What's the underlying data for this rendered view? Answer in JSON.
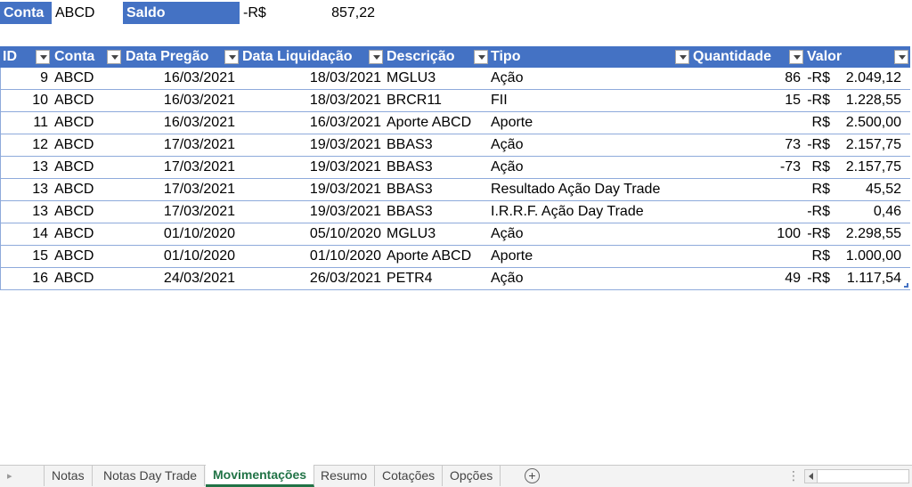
{
  "summary": {
    "conta_label": "Conta",
    "conta_value": "ABCD",
    "saldo_label": "Saldo",
    "saldo_currency": "-R$",
    "saldo_value": "857,22"
  },
  "table": {
    "headers": {
      "id": "ID",
      "conta": "Conta",
      "pregao": "Data Pregão",
      "liquidacao": "Data Liquidação",
      "descricao": "Descrição",
      "tipo": "Tipo",
      "quantidade": "Quantidade",
      "valor": "Valor"
    },
    "rows": [
      {
        "id": "9",
        "conta": "ABCD",
        "pregao": "16/03/2021",
        "liquidacao": "18/03/2021",
        "descricao": "MGLU3",
        "tipo": "Ação",
        "quantidade": "86",
        "currency": "-R$",
        "valor": "2.049,12"
      },
      {
        "id": "10",
        "conta": "ABCD",
        "pregao": "16/03/2021",
        "liquidacao": "18/03/2021",
        "descricao": "BRCR11",
        "tipo": "FII",
        "quantidade": "15",
        "currency": "-R$",
        "valor": "1.228,55"
      },
      {
        "id": "11",
        "conta": "ABCD",
        "pregao": "16/03/2021",
        "liquidacao": "16/03/2021",
        "descricao": "Aporte ABCD",
        "tipo": "Aporte",
        "quantidade": "",
        "currency": "R$",
        "valor": "2.500,00"
      },
      {
        "id": "12",
        "conta": "ABCD",
        "pregao": "17/03/2021",
        "liquidacao": "19/03/2021",
        "descricao": "BBAS3",
        "tipo": "Ação",
        "quantidade": "73",
        "currency": "-R$",
        "valor": "2.157,75"
      },
      {
        "id": "13",
        "conta": "ABCD",
        "pregao": "17/03/2021",
        "liquidacao": "19/03/2021",
        "descricao": "BBAS3",
        "tipo": "Ação",
        "quantidade": "-73",
        "currency": "R$",
        "valor": "2.157,75"
      },
      {
        "id": "13",
        "conta": "ABCD",
        "pregao": "17/03/2021",
        "liquidacao": "19/03/2021",
        "descricao": "BBAS3",
        "tipo": "Resultado Ação Day Trade",
        "quantidade": "",
        "currency": "R$",
        "valor": "45,52"
      },
      {
        "id": "13",
        "conta": "ABCD",
        "pregao": "17/03/2021",
        "liquidacao": "19/03/2021",
        "descricao": "BBAS3",
        "tipo": "I.R.R.F. Ação Day Trade",
        "quantidade": "",
        "currency": "-R$",
        "valor": "0,46"
      },
      {
        "id": "14",
        "conta": "ABCD",
        "pregao": "01/10/2020",
        "liquidacao": "05/10/2020",
        "descricao": "MGLU3",
        "tipo": "Ação",
        "quantidade": "100",
        "currency": "-R$",
        "valor": "2.298,55"
      },
      {
        "id": "15",
        "conta": "ABCD",
        "pregao": "01/10/2020",
        "liquidacao": "01/10/2020",
        "descricao": "Aporte ABCD",
        "tipo": "Aporte",
        "quantidade": "",
        "currency": "R$",
        "valor": "1.000,00"
      },
      {
        "id": "16",
        "conta": "ABCD",
        "pregao": "24/03/2021",
        "liquidacao": "26/03/2021",
        "descricao": "PETR4",
        "tipo": "Ação",
        "quantidade": "49",
        "currency": "-R$",
        "valor": "1.117,54"
      }
    ]
  },
  "sheet_tabs": [
    "Notas",
    "Notas Day Trade",
    "Movimentações",
    "Resumo",
    "Cotações",
    "Opções"
  ],
  "active_sheet": "Movimentações",
  "colors": {
    "header_blue": "#4472c4",
    "row_border": "#8eaadb",
    "active_tab_green": "#217346"
  }
}
